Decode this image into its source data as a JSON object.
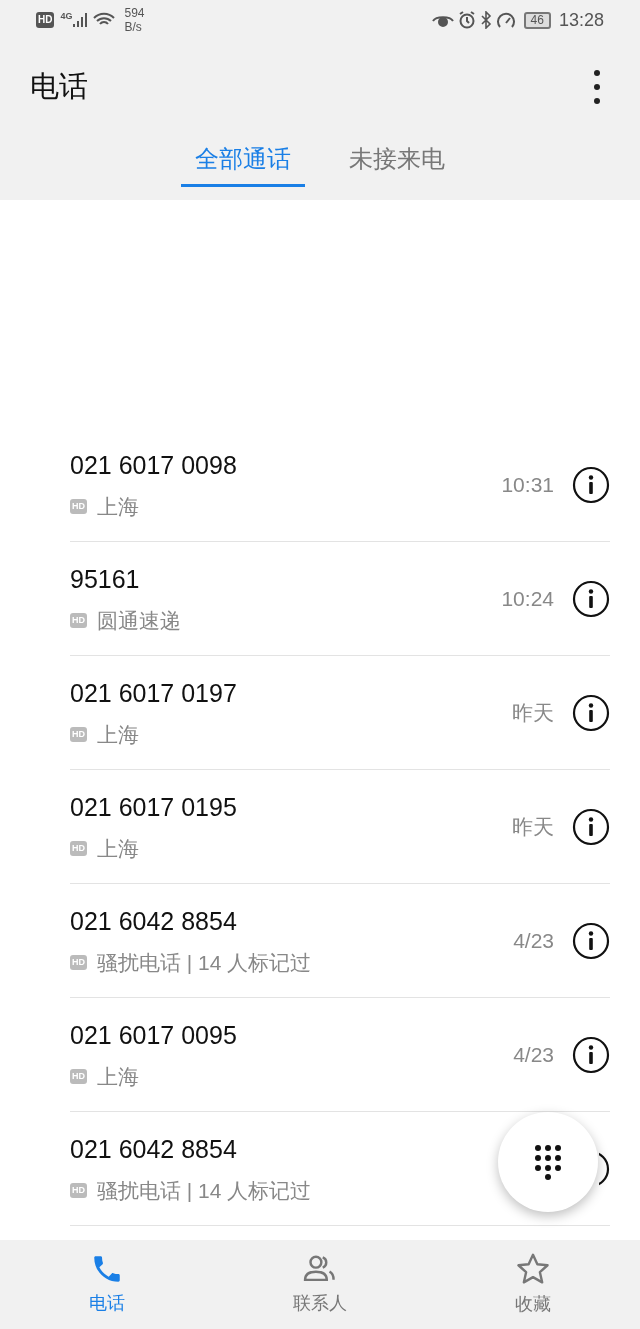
{
  "status_bar": {
    "hd": "HD",
    "network": "4G",
    "speed": "594",
    "speed_unit": "B/s",
    "battery": "46",
    "time": "13:28"
  },
  "header": {
    "title": "电话"
  },
  "tabs": [
    {
      "label": "全部通话",
      "selected": true
    },
    {
      "label": "未接来电",
      "selected": false
    }
  ],
  "calls": [
    {
      "number": "021 6017 0098",
      "badge": "HD",
      "location": "上海",
      "time": "10:31"
    },
    {
      "number": "95161",
      "badge": "HD",
      "location": "圆通速递",
      "time": "10:24"
    },
    {
      "number": "021 6017 0197",
      "badge": "HD",
      "location": "上海",
      "time": "昨天"
    },
    {
      "number": "021 6017 0195",
      "badge": "HD",
      "location": "上海",
      "time": "昨天"
    },
    {
      "number": "021 6042 8854",
      "badge": "HD",
      "location": "骚扰电话 | 14 人标记过",
      "time": "4/23"
    },
    {
      "number": "021 6017 0095",
      "badge": "HD",
      "location": "上海",
      "time": "4/23"
    },
    {
      "number": "021 6042 8854",
      "badge": "HD",
      "location": "骚扰电话 | 14 人标记过"
    }
  ],
  "bottom_nav": [
    {
      "label": "电话",
      "kind": "phone",
      "selected": true
    },
    {
      "label": "联系人",
      "kind": "contacts",
      "selected": false
    },
    {
      "label": "收藏",
      "kind": "star",
      "selected": false
    }
  ]
}
